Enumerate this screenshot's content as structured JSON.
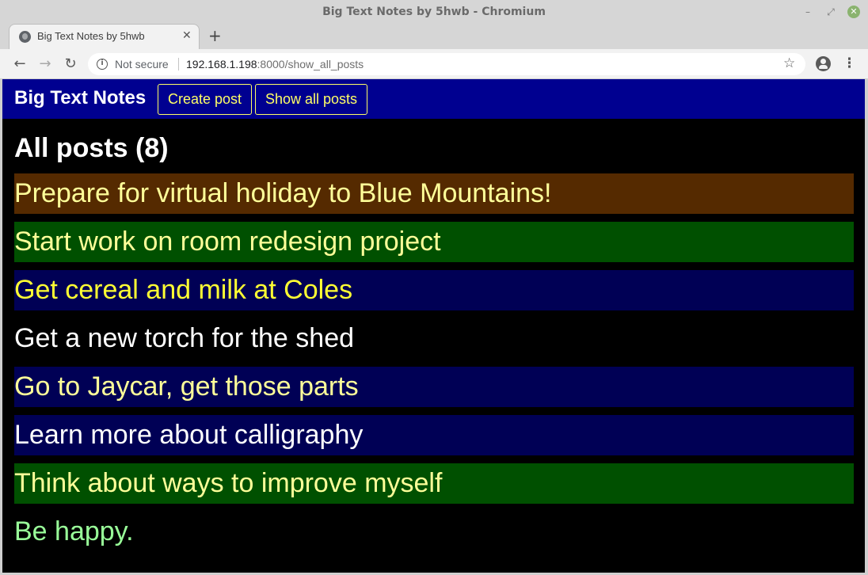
{
  "window": {
    "title": "Big Text Notes by 5hwb - Chromium"
  },
  "tab": {
    "title": "Big Text Notes by 5hwb"
  },
  "omnibox": {
    "security": "Not secure",
    "host": "192.168.1.198",
    "path": ":8000/show_all_posts"
  },
  "navbar": {
    "brand": "Big Text Notes",
    "create_label": "Create post",
    "showall_label": "Show all posts"
  },
  "heading": "All posts (8)",
  "posts": [
    {
      "text": "Prepare for virtual holiday to Blue Mountains!",
      "bg": "#552a00",
      "fg": "#ffff99"
    },
    {
      "text": "Start work on room redesign project",
      "bg": "#005000",
      "fg": "#ffff99"
    },
    {
      "text": "Get cereal and milk at Coles",
      "bg": "#000055",
      "fg": "#ffff33"
    },
    {
      "text": "Get a new torch for the shed",
      "bg": "#000000",
      "fg": "#ffffff"
    },
    {
      "text": "Go to Jaycar, get those parts",
      "bg": "#000055",
      "fg": "#ffff99"
    },
    {
      "text": "Learn more about calligraphy",
      "bg": "#000055",
      "fg": "#ffffff"
    },
    {
      "text": "Think about ways to improve myself",
      "bg": "#005000",
      "fg": "#ffff99"
    },
    {
      "text": "Be happy.",
      "bg": "#000000",
      "fg": "#99ff99"
    }
  ],
  "colors": {
    "navbar": "#000090",
    "page_bg": "#000000",
    "nav_link": "#ffff66"
  }
}
